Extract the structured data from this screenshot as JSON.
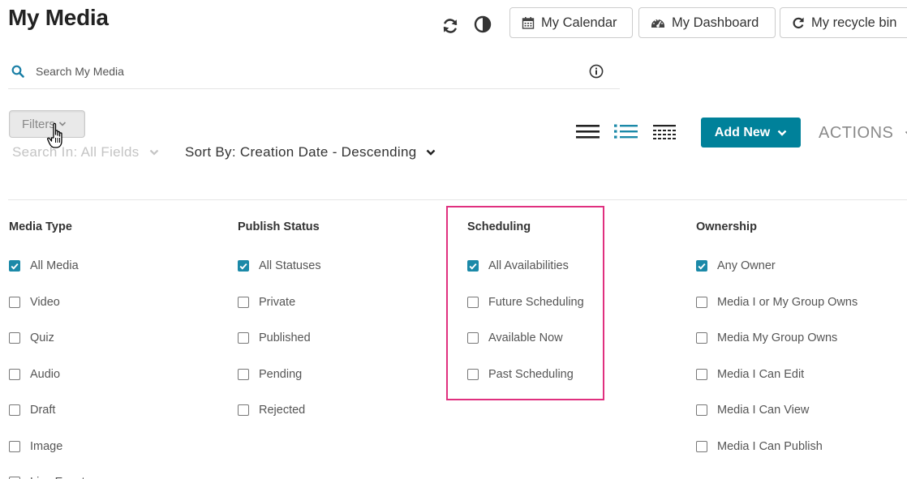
{
  "page": {
    "title": "My Media"
  },
  "toolbar": {
    "refresh_icon": "refresh-icon",
    "contrast_icon": "contrast-icon",
    "buttons": [
      {
        "label": "My Calendar",
        "icon": "calendar-icon"
      },
      {
        "label": "My Dashboard",
        "icon": "dashboard-icon"
      },
      {
        "label": "My recycle bin",
        "icon": "recycle-icon"
      }
    ]
  },
  "search": {
    "placeholder": "Search My Media",
    "value": ""
  },
  "filters": {
    "button_label": "Filters",
    "search_in": "Search In: All Fields",
    "sort_by": "Sort By: Creation Date - Descending"
  },
  "actions_bar": {
    "add_new_label": "Add New",
    "actions_label": "ACTIONS"
  },
  "filter_columns": [
    {
      "title": "Media Type",
      "options": [
        {
          "label": "All Media",
          "checked": true
        },
        {
          "label": "Video",
          "checked": false
        },
        {
          "label": "Quiz",
          "checked": false
        },
        {
          "label": "Audio",
          "checked": false
        },
        {
          "label": "Draft",
          "checked": false
        },
        {
          "label": "Image",
          "checked": false
        },
        {
          "label": "Live Events",
          "checked": false
        }
      ]
    },
    {
      "title": "Publish Status",
      "options": [
        {
          "label": "All Statuses",
          "checked": true
        },
        {
          "label": "Private",
          "checked": false
        },
        {
          "label": "Published",
          "checked": false
        },
        {
          "label": "Pending",
          "checked": false
        },
        {
          "label": "Rejected",
          "checked": false
        }
      ]
    },
    {
      "title": "Scheduling",
      "options": [
        {
          "label": "All Availabilities",
          "checked": true
        },
        {
          "label": "Future Scheduling",
          "checked": false
        },
        {
          "label": "Available Now",
          "checked": false
        },
        {
          "label": "Past Scheduling",
          "checked": false
        }
      ]
    },
    {
      "title": "Ownership",
      "options": [
        {
          "label": "Any Owner",
          "checked": true
        },
        {
          "label": "Media I or My Group Owns",
          "checked": false
        },
        {
          "label": "Media My Group Owns",
          "checked": false
        },
        {
          "label": "Media I Can Edit",
          "checked": false
        },
        {
          "label": "Media I Can View",
          "checked": false
        },
        {
          "label": "Media I Can Publish",
          "checked": false
        }
      ]
    }
  ],
  "colors": {
    "accent": "#00819a",
    "checkbox_checked": "#1b89a8",
    "highlight_border": "#e0307f"
  }
}
